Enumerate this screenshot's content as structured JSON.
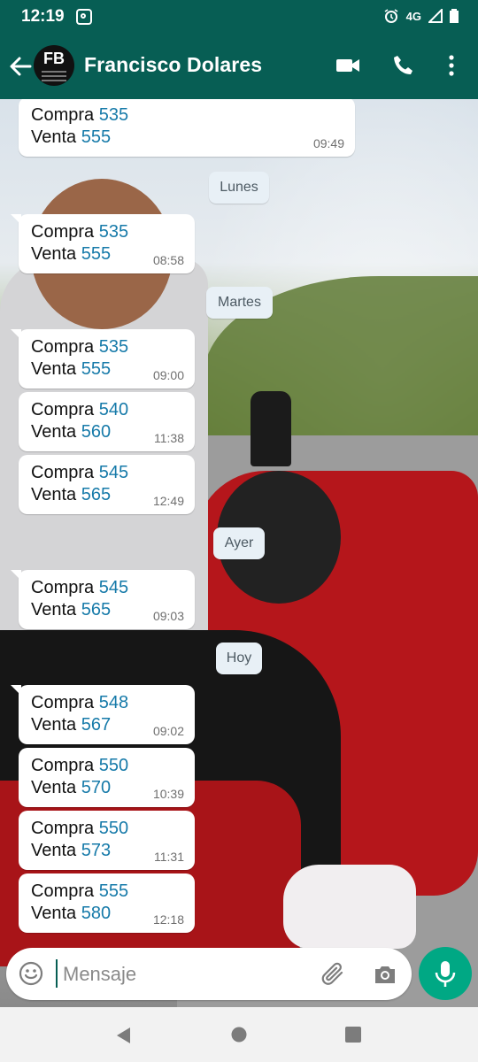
{
  "status_bar": {
    "time": "12:19",
    "network": "4G"
  },
  "header": {
    "contact_name": "Francisco Dolares",
    "avatar_initials": "FB"
  },
  "messages": [
    {
      "buy_label": "Compra",
      "buy_value": "535",
      "sell_label": "Venta",
      "sell_value": "555",
      "time": "09:49"
    },
    {
      "buy_label": "Compra",
      "buy_value": "535",
      "sell_label": "Venta",
      "sell_value": "555",
      "time": "08:58"
    },
    {
      "buy_label": "Compra",
      "buy_value": "535",
      "sell_label": "Venta",
      "sell_value": "555",
      "time": "09:00"
    },
    {
      "buy_label": "Compra",
      "buy_value": "540",
      "sell_label": "Venta",
      "sell_value": "560",
      "time": "11:38"
    },
    {
      "buy_label": "Compra",
      "buy_value": "545",
      "sell_label": "Venta",
      "sell_value": "565",
      "time": "12:49"
    },
    {
      "buy_label": "Compra",
      "buy_value": "545",
      "sell_label": "Venta",
      "sell_value": "565",
      "time": "09:03"
    },
    {
      "buy_label": "Compra",
      "buy_value": "548",
      "sell_label": "Venta",
      "sell_value": "567",
      "time": "09:02"
    },
    {
      "buy_label": "Compra",
      "buy_value": "550",
      "sell_label": "Venta",
      "sell_value": "570",
      "time": "10:39"
    },
    {
      "buy_label": "Compra",
      "buy_value": "550",
      "sell_label": "Venta",
      "sell_value": "573",
      "time": "11:31"
    },
    {
      "buy_label": "Compra",
      "buy_value": "555",
      "sell_label": "Venta",
      "sell_value": "580",
      "time": "12:18"
    }
  ],
  "date_separators": [
    "Lunes",
    "Martes",
    "Ayer",
    "Hoy"
  ],
  "composer": {
    "placeholder": "Mensaje"
  },
  "colors": {
    "header": "#075e54",
    "accent": "#00a884",
    "number": "#167aa9",
    "bubble": "#ffffff"
  }
}
